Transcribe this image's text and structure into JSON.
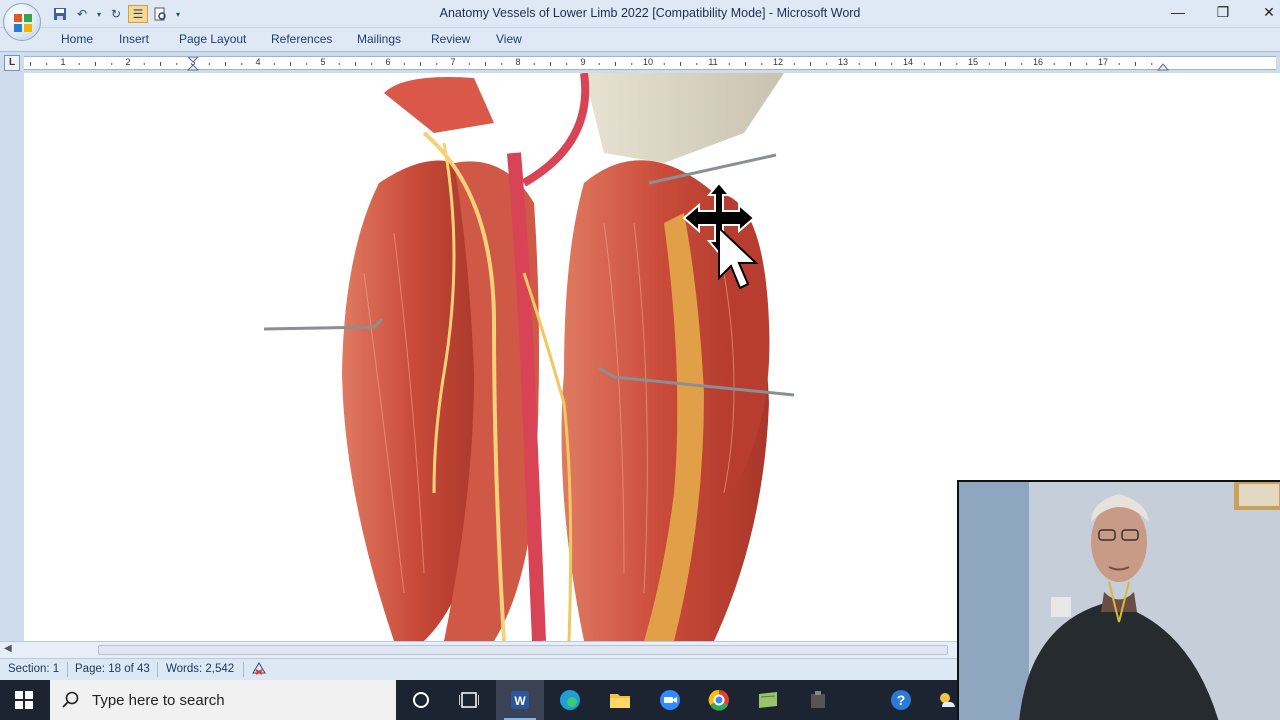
{
  "window": {
    "title": "Anatomy Vessels of Lower Limb 2022 [Compatibility Mode] - Microsoft Word",
    "controls": {
      "minimize": "—",
      "restore": "❐",
      "close": "✕"
    }
  },
  "ribbon": {
    "tabs": [
      "Home",
      "Insert",
      "Page Layout",
      "References",
      "Mailings",
      "Review",
      "View"
    ]
  },
  "ruler": {
    "corner": "L",
    "labels": [
      "1",
      "2",
      "3",
      "4",
      "5",
      "6",
      "7",
      "8",
      "9",
      "10",
      "11",
      "12",
      "13",
      "14",
      "15",
      "16",
      "17"
    ]
  },
  "status": {
    "section": "Section: 1",
    "page": "Page: 18 of 43",
    "words": "Words: 2,542"
  },
  "taskbar": {
    "search_placeholder": "Type here to search",
    "icons": [
      "windows-start-icon",
      "search-icon",
      "cortana-icon",
      "task-view-icon",
      "word-icon",
      "edge-icon",
      "file-explorer-icon",
      "zoom-icon",
      "chrome-icon",
      "sticky-notes-icon",
      "app-icon",
      "help-icon",
      "weather-icon"
    ]
  },
  "colors": {
    "ribbon_bg": "#dfe9f6",
    "tab_text": "#1d3e72",
    "muscle": "#c94a38",
    "taskbar": "#1c2331"
  }
}
